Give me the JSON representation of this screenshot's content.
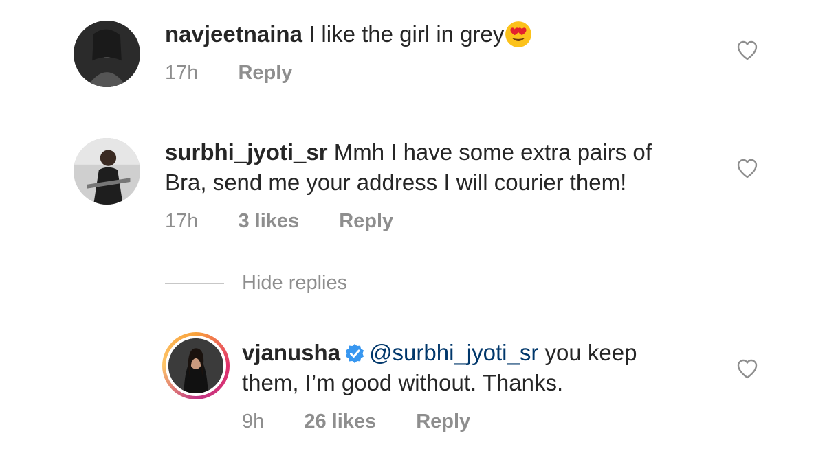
{
  "comments": [
    {
      "username": "navjeetnaina",
      "text": " I like the girl in grey",
      "emoji": "heart-eyes-emoji",
      "time": "17h",
      "reply": "Reply"
    },
    {
      "username": "surbhi_jyoti_sr",
      "text_line1": " Mmh I have some extra pairs of",
      "text_line2": "Bra, send me your address I will courier them!",
      "time": "17h",
      "likes": "3 likes",
      "reply": "Reply"
    }
  ],
  "hide_replies": "Hide replies",
  "reply_comment": {
    "username": "vjanusha",
    "verified": true,
    "mention": "@surbhi_jyoti_sr",
    "text_line1": " you keep",
    "text_line2": "them, I’m good without. Thanks.",
    "time": "9h",
    "likes": "26 likes",
    "reply": "Reply"
  },
  "colors": {
    "text": "#262626",
    "secondary": "#8e8e8e",
    "verified": "#3897f0",
    "mention": "#00376b"
  }
}
